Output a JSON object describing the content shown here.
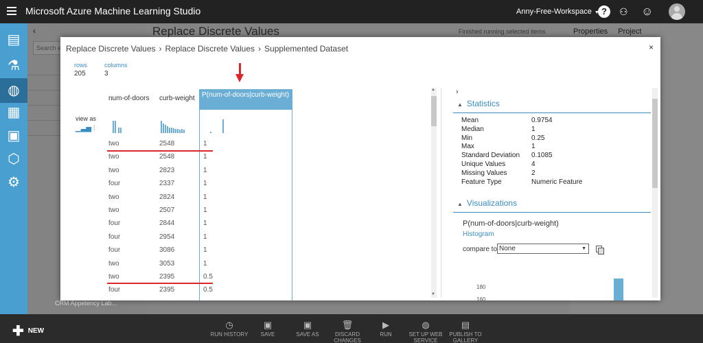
{
  "app": {
    "title": "Microsoft Azure Machine Learning Studio",
    "workspace": "Anny-Free-Workspace",
    "help_icon": "?"
  },
  "background": {
    "search_placeholder": "Search ex",
    "canvas_title": "Replace Discrete Values",
    "status": "Finished running selected items",
    "right_tabs": [
      "Properties",
      "Project"
    ],
    "left_tree_bottom": "CRM Appetency Lab..."
  },
  "modal": {
    "breadcrumb": [
      "Replace Discrete Values",
      "Replace Discrete Values",
      "Supplemented Dataset"
    ],
    "close_label": "×",
    "rows_label": "rows",
    "rows_value": "205",
    "columns_label": "columns",
    "columns_value": "3",
    "view_as_label": "view as",
    "columns": [
      "num-of-doors",
      "curb-weight",
      "P(num-of-doors|curb-weight)"
    ],
    "rows": [
      [
        "two",
        "2548",
        "1"
      ],
      [
        "two",
        "2548",
        "1"
      ],
      [
        "two",
        "2823",
        "1"
      ],
      [
        "four",
        "2337",
        "1"
      ],
      [
        "two",
        "2824",
        "1"
      ],
      [
        "two",
        "2507",
        "1"
      ],
      [
        "four",
        "2844",
        "1"
      ],
      [
        "four",
        "2954",
        "1"
      ],
      [
        "four",
        "3086",
        "1"
      ],
      [
        "two",
        "3053",
        "1"
      ],
      [
        "two",
        "2395",
        "0.5"
      ],
      [
        "four",
        "2395",
        "0.5"
      ]
    ],
    "statistics": {
      "title": "Statistics",
      "items": [
        {
          "key": "Mean",
          "value": "0.9754"
        },
        {
          "key": "Median",
          "value": "1"
        },
        {
          "key": "Min",
          "value": "0.25"
        },
        {
          "key": "Max",
          "value": "1"
        },
        {
          "key": "Standard Deviation",
          "value": "0.1085"
        },
        {
          "key": "Unique Values",
          "value": "4"
        },
        {
          "key": "Missing Values",
          "value": "2"
        },
        {
          "key": "Feature Type",
          "value": "Numeric Feature"
        }
      ]
    },
    "visualizations": {
      "title": "Visualizations",
      "chart_title": "P(num-of-doors|curb-weight)",
      "chart_type_link": "Histogram",
      "compare_label": "compare to",
      "compare_value": "None",
      "axis_tick_1": "180",
      "axis_tick_2": "160"
    }
  },
  "commands": [
    {
      "icon": "clock-icon",
      "label": "RUN HISTORY"
    },
    {
      "icon": "save-icon",
      "label": "SAVE"
    },
    {
      "icon": "save-as-icon",
      "label": "SAVE AS"
    },
    {
      "icon": "trash-icon",
      "label": "DISCARD CHANGES"
    },
    {
      "icon": "play-icon",
      "label": "RUN"
    },
    {
      "icon": "web-service-icon",
      "label": "SET UP WEB SERVICE"
    },
    {
      "icon": "gallery-icon",
      "label": "PUBLISH TO GALLERY"
    }
  ],
  "new_label": "NEW",
  "colors": {
    "accent": "#4a9fd1",
    "selected_column": "#6aaed6",
    "annotation_red": "#d9262b"
  }
}
